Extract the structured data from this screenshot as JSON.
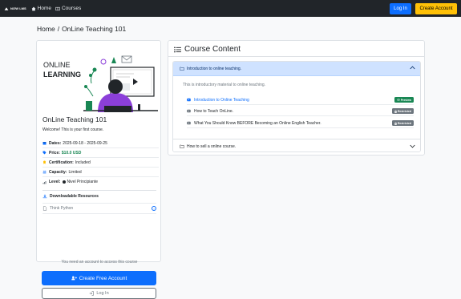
{
  "nav": {
    "brand": "NƠW LMS",
    "home": "Home",
    "courses": "Courses",
    "login": "Log In",
    "create_account": "Create Account"
  },
  "breadcrumb": {
    "home": "Home",
    "sep": "/",
    "current": "OnLine Teaching 101"
  },
  "hero": {
    "line1": "ONLINE",
    "line2": "LEARNING"
  },
  "course": {
    "title": "OnLine Teaching 101",
    "welcome": "Welcome! This is your first course.",
    "meta": {
      "dates_key": "Dates:",
      "dates_val": "2025-09-18 - 2025-09-25",
      "price_key": "Price:",
      "price_val": "$10.0 USD",
      "cert_key": "Certification:",
      "cert_val": "Included",
      "cap_key": "Capacity:",
      "cap_val": "Limited",
      "level_key": "Level:",
      "level_val": "Nivel Principiante"
    }
  },
  "downloads": {
    "title": "Downloadable Resources",
    "item": "Think Python"
  },
  "access": {
    "need_account": "You need an account to access this course",
    "create_free": "Create Free Account",
    "login": "Log In"
  },
  "content": {
    "header": "Course Content",
    "section1": {
      "title": "Introduction to online teaching.",
      "intro": "This is introductory material to online teaching.",
      "lessons": [
        {
          "title": "Introduction to Online Teaching",
          "badge": "Preview"
        },
        {
          "title": "How to Teach OnLine.",
          "badge": "Restricted"
        },
        {
          "title": "What You Should Know BEFORE Becoming an Online English Teacher.",
          "badge": "Restricted"
        }
      ]
    },
    "section2": {
      "title": "How to sell a online course."
    }
  },
  "colors": {
    "primary": "#0d6efd",
    "warning": "#ffc107",
    "success": "#198754",
    "secondary": "#6c757d",
    "purple": "#8b3fd9",
    "dark": "#212529"
  }
}
